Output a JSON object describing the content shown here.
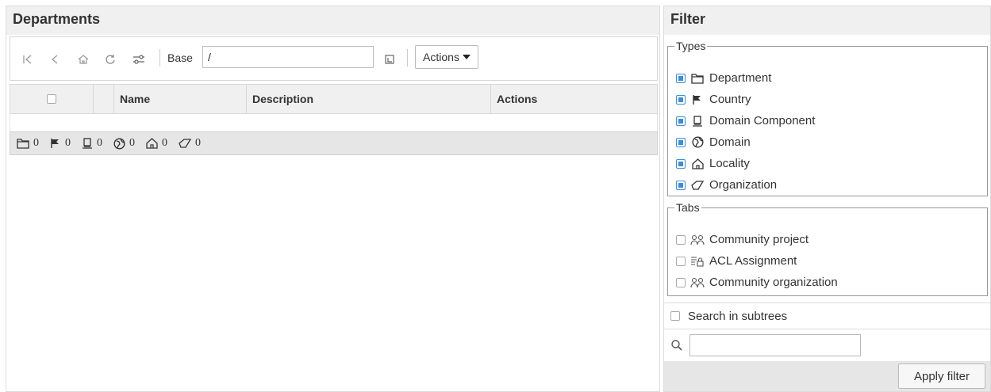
{
  "departments": {
    "title": "Departments",
    "toolbar": {
      "icons": [
        "first-page-icon",
        "back-icon",
        "home-icon",
        "reload-icon",
        "settings-icon"
      ],
      "base_label": "Base",
      "base_value": "/",
      "actions_label": "Actions"
    },
    "grid": {
      "columns": [
        "Name",
        "Description",
        "Actions"
      ],
      "counts": [
        {
          "icon": "department-icon",
          "count": "0"
        },
        {
          "icon": "country-icon",
          "count": "0"
        },
        {
          "icon": "domain-component-icon",
          "count": "0"
        },
        {
          "icon": "domain-icon",
          "count": "0"
        },
        {
          "icon": "locality-icon",
          "count": "0"
        },
        {
          "icon": "organization-icon",
          "count": "0"
        }
      ]
    }
  },
  "filter": {
    "title": "Filter",
    "types_legend": "Types",
    "types": [
      {
        "label": "Department",
        "icon": "department-icon",
        "checked": true
      },
      {
        "label": "Country",
        "icon": "country-icon",
        "checked": true
      },
      {
        "label": "Domain Component",
        "icon": "domain-component-icon",
        "checked": true
      },
      {
        "label": "Domain",
        "icon": "domain-icon",
        "checked": true
      },
      {
        "label": "Locality",
        "icon": "locality-icon",
        "checked": true
      },
      {
        "label": "Organization",
        "icon": "organization-icon",
        "checked": true
      }
    ],
    "tabs_legend": "Tabs",
    "tabs": [
      {
        "label": "Community project",
        "icon": "community-icon",
        "checked": false
      },
      {
        "label": "ACL Assignment",
        "icon": "acl-icon",
        "checked": false
      },
      {
        "label": "Community organization",
        "icon": "community-icon",
        "checked": false
      }
    ],
    "search_subtrees_label": "Search in subtrees",
    "search_placeholder": "",
    "apply_label": "Apply filter"
  },
  "colors": {
    "accent": "#3b8ed8",
    "header_bg": "#f0f0f0",
    "footer_bg": "#e6e6e6"
  }
}
